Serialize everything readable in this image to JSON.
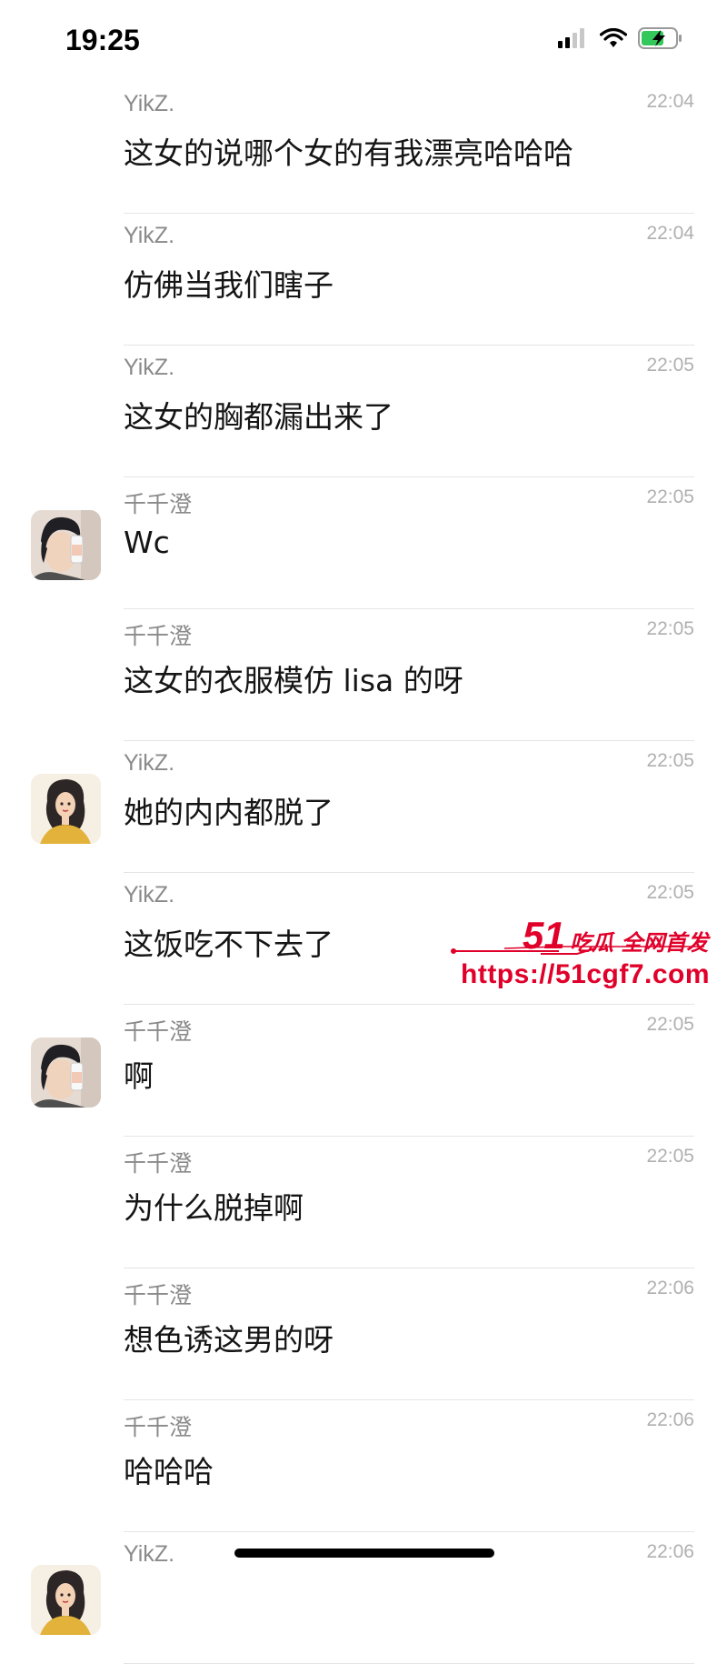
{
  "status_bar": {
    "time": "19:25"
  },
  "messages": [
    {
      "avatar": "none",
      "name": "YikZ.",
      "time": "22:04",
      "text": "这女的说哪个女的有我漂亮哈哈哈"
    },
    {
      "avatar": "none",
      "name": "YikZ.",
      "time": "22:04",
      "text": "仿佛当我们瞎子"
    },
    {
      "avatar": "none",
      "name": "YikZ.",
      "time": "22:05",
      "text": "这女的胸都漏出来了"
    },
    {
      "avatar": "photo",
      "name": "千千澄",
      "time": "22:05",
      "text": "Wc"
    },
    {
      "avatar": "none",
      "name": "千千澄",
      "time": "22:05",
      "text": "这女的衣服模仿 lisa 的呀"
    },
    {
      "avatar": "cartoon",
      "name": "YikZ.",
      "time": "22:05",
      "text": "她的内内都脱了"
    },
    {
      "avatar": "none",
      "name": "YikZ.",
      "time": "22:05",
      "text": "这饭吃不下去了"
    },
    {
      "avatar": "photo",
      "name": "千千澄",
      "time": "22:05",
      "text": "啊"
    },
    {
      "avatar": "none",
      "name": "千千澄",
      "time": "22:05",
      "text": "为什么脱掉啊"
    },
    {
      "avatar": "none",
      "name": "千千澄",
      "time": "22:06",
      "text": "想色诱这男的呀"
    },
    {
      "avatar": "none",
      "name": "千千澄",
      "time": "22:06",
      "text": "哈哈哈"
    },
    {
      "avatar": "cartoon",
      "name": "YikZ.",
      "time": "22:06",
      "text": ""
    }
  ],
  "watermark": {
    "number": "51",
    "slogan": "吃瓜 全网首发",
    "url": "https://51cgf7.com",
    "color": "#e0002a"
  }
}
